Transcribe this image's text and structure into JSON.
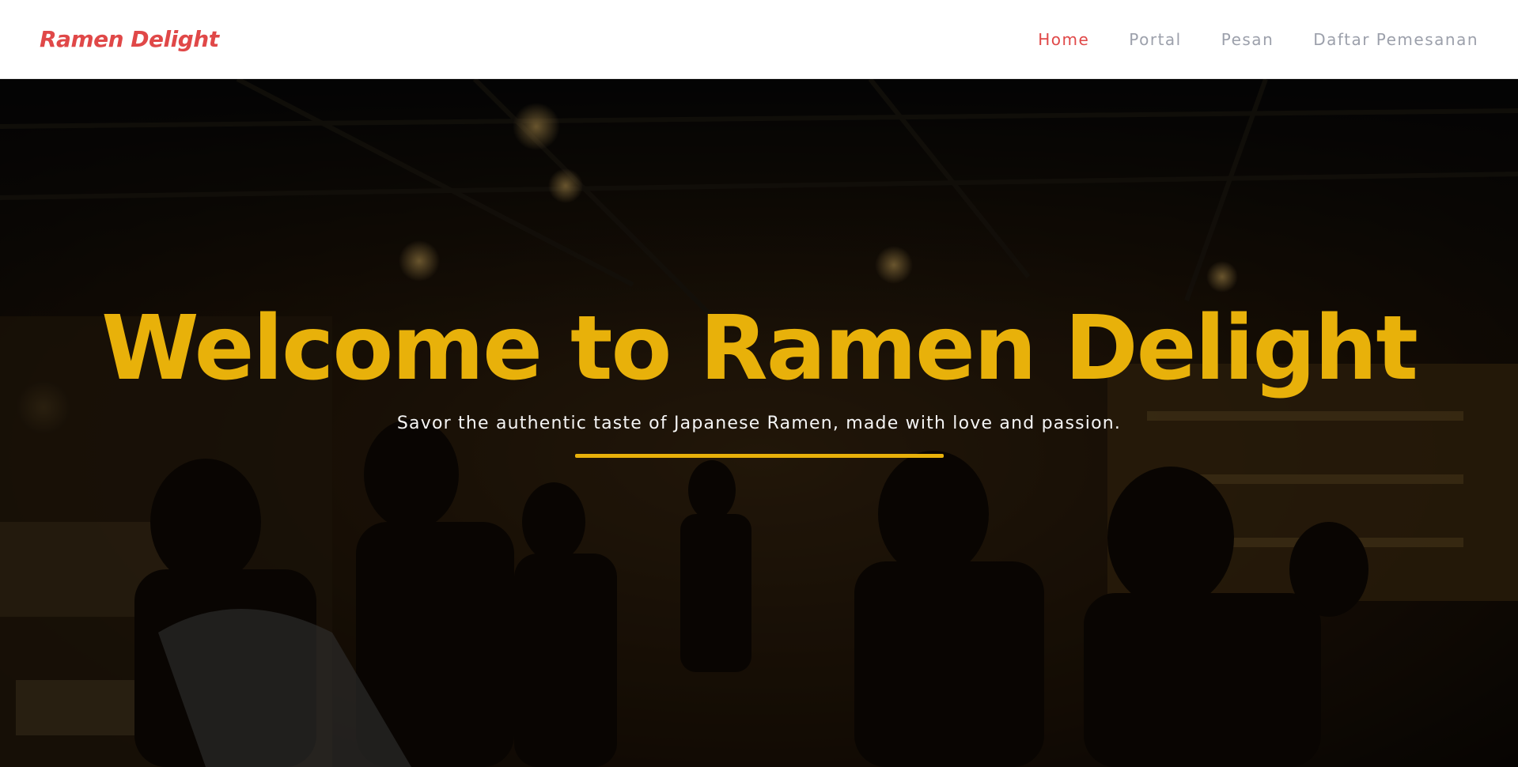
{
  "navbar": {
    "brand": "Ramen Delight",
    "links": [
      {
        "label": "Home",
        "active": true
      },
      {
        "label": "Portal",
        "active": false
      },
      {
        "label": "Pesan",
        "active": false
      },
      {
        "label": "Daftar Pemesanan",
        "active": false
      }
    ]
  },
  "hero": {
    "title": "Welcome to Ramen Delight",
    "subtitle": "Savor the authentic taste of Japanese Ramen, made with love and passion."
  },
  "colors": {
    "brand_red": "#e04848",
    "nav_gray": "#9ca0ab",
    "accent_gold": "#e8b10a",
    "navbar_bg": "#ffffff"
  }
}
